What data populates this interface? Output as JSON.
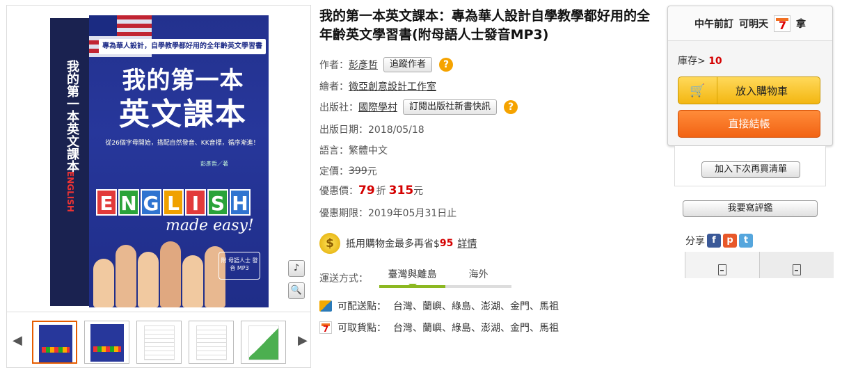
{
  "book": {
    "title": "我的第一本英文課本：專為華人設計自學教學都好用的全年齡英文學習書(附母語人士發音MP3)",
    "author_label": "作者：",
    "author": "彭彥哲",
    "follow_author": "追蹤作者",
    "illustrator_label": "繪者：",
    "illustrator": "微亞創意設計工作室",
    "publisher_label": "出版社：",
    "publisher": "國際學村",
    "subscribe_publisher": "訂閱出版社新書快訊",
    "pubdate": "出版日期：2018/05/18",
    "language": "語言：繁體中文",
    "list_price_label": "定價：",
    "list_price": "399",
    "list_price_unit": "元",
    "discount_label": "優惠價：",
    "discount": "79",
    "discount_unit": "折",
    "sale_price": "315",
    "sale_unit": "元",
    "offer_deadline": "優惠期限：2019年05月31日止",
    "coupon_text": "抵用購物金最多再省$",
    "coupon_amount": "95",
    "coupon_details": "詳情"
  },
  "cover": {
    "banner": "專為華人設計，自學教學都好用的全年齡英文學習書",
    "title1": "我的第一本",
    "title2": "英文課本",
    "subtitle": "從26個字母開始，搭配自然發音、KK音標，循序漸進！",
    "author": "彭彥哲／著",
    "english_letters": [
      "E",
      "N",
      "G",
      "L",
      "I",
      "S",
      "H"
    ],
    "english_colors": [
      "#e23a3a",
      "#2aa33a",
      "#2f74d0",
      "#f0a100",
      "#e23a3a",
      "#2aa33a",
      "#2f74d0"
    ],
    "made_easy": "made easy!",
    "mp3_badge": "附 母語人士 發音 MP3",
    "side_title": "我的第一本英文課本",
    "side_english": "ENGLISH"
  },
  "gallery": {
    "left_arrow": "◀",
    "right_arrow": "▶",
    "music_icon": "♪",
    "zoom_icon": "🔍"
  },
  "shipping": {
    "label": "運送方式：",
    "tabs": [
      "臺灣與離島",
      "海外"
    ],
    "deliver_label": "可配送點：",
    "deliver_places": "台灣、蘭嶼、綠島、澎湖、金門、馬祖",
    "pickup_label": "可取貨點：",
    "pickup_places": "台灣、蘭嶼、綠島、澎湖、金門、馬祖"
  },
  "purchase": {
    "header_left": "中午前訂",
    "header_right": "可明天",
    "header_end": "拿",
    "stock_label": "庫存>",
    "stock_count": "10",
    "add_to_cart": "放入購物車",
    "checkout": "直接結帳",
    "wishlist": "加入下次再買清單",
    "review": "我要寫評鑑",
    "share_label": "分享"
  },
  "colors": {
    "cart": "#f3b611",
    "checkout": "#f26313",
    "price": "#d40000",
    "tab_active": "#8cb821"
  }
}
